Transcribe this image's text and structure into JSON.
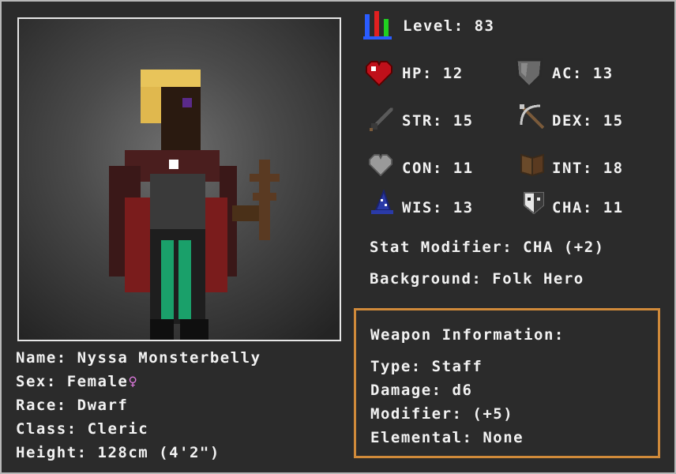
{
  "character": {
    "name_line": "Name: Nyssa Monsterbelly",
    "sex_line": "Sex: Female",
    "sex_symbol": "♀",
    "race_line": "Race: Dwarf",
    "class_line": "Class: Cleric",
    "height_line": "Height: 128cm (4'2\")"
  },
  "stats": {
    "level": "Level: 83",
    "hp": "HP: 12",
    "ac": "AC: 13",
    "str": "STR: 15",
    "dex": "DEX: 15",
    "con": "CON: 11",
    "int": "INT: 18",
    "wis": "WIS: 13",
    "cha": "CHA: 11",
    "stat_modifier": "Stat Modifier: CHA (+2)",
    "background": "Background: Folk Hero"
  },
  "weapon": {
    "header": "Weapon Information:",
    "type": "Type: Staff",
    "damage": "Damage: d6",
    "modifier": "Modifier: (+5)",
    "elemental": "Elemental: None"
  },
  "icons": [
    "level-bars-icon",
    "heart-icon",
    "shield-icon",
    "sword-icon",
    "crossbow-icon",
    "con-heart-icon",
    "book-icon",
    "wizard-hat-icon",
    "mask-icon"
  ],
  "colors": {
    "accent_border": "#d08a3a",
    "text": "#f2f2f2",
    "background": "#2b2b2b"
  }
}
